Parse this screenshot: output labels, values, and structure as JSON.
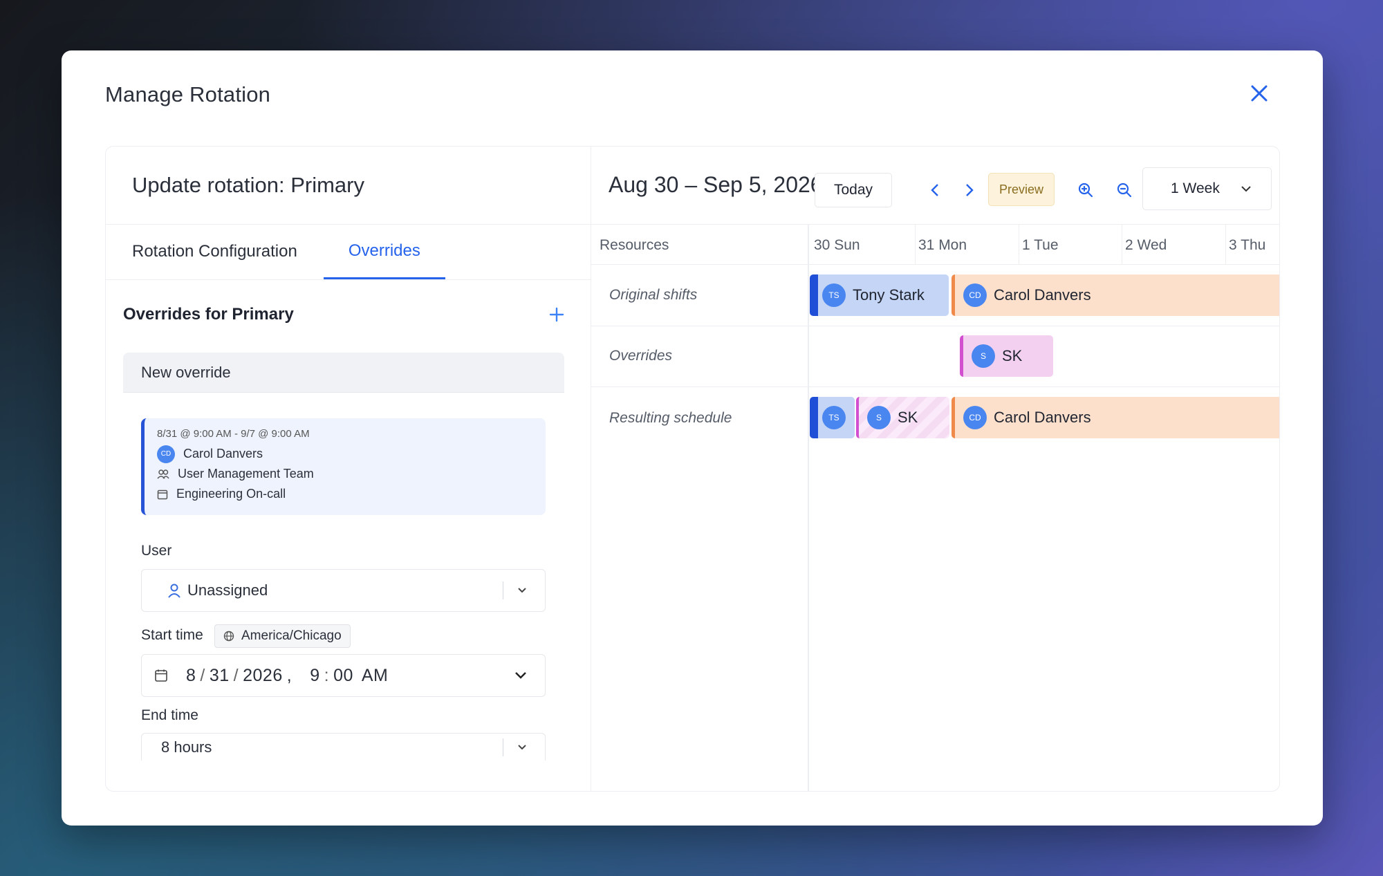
{
  "modal": {
    "title": "Manage Rotation"
  },
  "left": {
    "header": "Update rotation: Primary",
    "tabs": [
      {
        "label": "Rotation Configuration",
        "active": false
      },
      {
        "label": "Overrides",
        "active": true
      }
    ],
    "overrides_title": "Overrides for Primary",
    "new_override": {
      "title": "New override",
      "summary": {
        "range": "8/31 @ 9:00 AM - 9/7 @ 9:00 AM",
        "user_initials": "CD",
        "user": "Carol Danvers",
        "team": "User Management Team",
        "calendar": "Engineering On-call"
      },
      "user_label": "User",
      "user_value": "Unassigned",
      "start_label": "Start time",
      "timezone": "America/Chicago",
      "start_date": {
        "month": "8",
        "day": "31",
        "year": "2026",
        "hour": "9",
        "minute": "00",
        "ampm": "AM"
      },
      "end_label": "End time",
      "end_value": "8 hours"
    }
  },
  "calendar": {
    "range": "Aug 30 – Sep 5, 2026",
    "today_label": "Today",
    "preview_label": "Preview",
    "view_label": "1 Week",
    "resources_label": "Resources",
    "days": [
      "30 Sun",
      "31 Mon",
      "1 Tue",
      "2 Wed",
      "3 Thu"
    ],
    "rows": [
      {
        "label": "Original shifts"
      },
      {
        "label": "Overrides"
      },
      {
        "label": "Resulting schedule"
      }
    ],
    "shifts": {
      "tony": {
        "initials": "TS",
        "name": "Tony Stark"
      },
      "carol": {
        "initials": "CD",
        "name": "Carol Danvers"
      },
      "sk": {
        "initials": "S",
        "name": "SK"
      }
    }
  },
  "colors": {
    "accent": "#2563eb",
    "tony_bg": "#c5d5f5",
    "tony_edge": "#1f4fd6",
    "carol_bg": "#fde0cc",
    "carol_edge": "#f08a4b",
    "sk_bg": "#f3d0f0",
    "sk_edge": "#d24fcf"
  }
}
